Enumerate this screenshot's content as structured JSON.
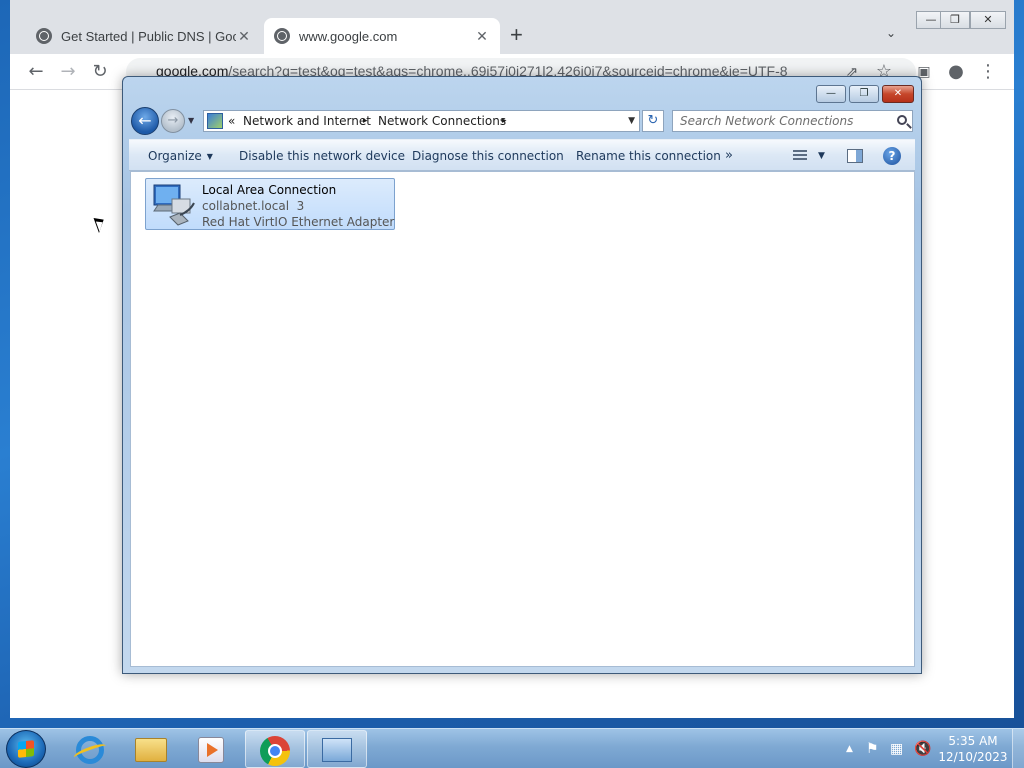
{
  "browser": {
    "tabs": [
      {
        "title": "Get Started  |  Public DNS  |  Goo",
        "close": "✕",
        "icon": "globe-icon"
      },
      {
        "title": "www.google.com",
        "close": "✕",
        "icon": "globe-icon"
      }
    ],
    "new_tab": "+",
    "tab_dropdown": "⌄",
    "url_host": "google.com",
    "url_rest": "/search?q=test&oq=test&aqs=chrome..69i57j0i271l2.426j0j7&sourceid=chrome&ie=UTF-8",
    "window_controls": {
      "minimize": "—",
      "restore": "❐",
      "close": "✕"
    }
  },
  "explorer": {
    "window_controls": {
      "minimize": "—",
      "restore": "❐",
      "close": "✕"
    },
    "breadcrumb": {
      "overflow": "«",
      "items": [
        "Network and Internet",
        "Network Connections"
      ],
      "separator": "▸"
    },
    "search": {
      "placeholder": "Search Network Connections"
    },
    "commands": {
      "organize": "Organize",
      "disable": "Disable this network device",
      "diagnose": "Diagnose this connection",
      "rename": "Rename this connection",
      "more": "»"
    },
    "connections": [
      {
        "name": "Local Area Connection",
        "network": "collabnet.local  3",
        "adapter": "Red Hat VirtIO Ethernet Adapter"
      }
    ]
  },
  "taskbar": {
    "clock": {
      "time": "5:35 AM",
      "date": "12/10/2023"
    },
    "tray_expand": "▲",
    "icons": [
      "internet-explorer-icon",
      "windows-explorer-icon",
      "media-player-icon",
      "chrome-icon",
      "network-connections-icon"
    ]
  }
}
